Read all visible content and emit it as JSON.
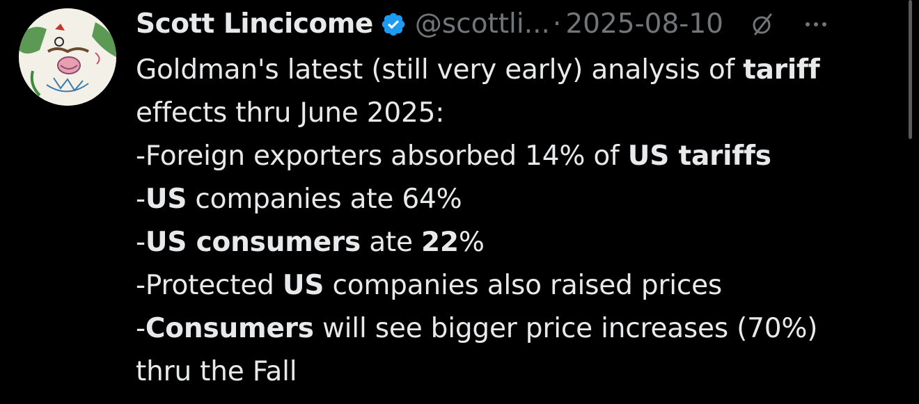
{
  "author": {
    "display_name": "Scott Lincicome",
    "handle": "@scottli...",
    "separator": "·",
    "date": "2025-08-10",
    "verified_icon": "verified-badge-icon",
    "verified_color": "#1d9bf0",
    "avatar_icon": "hand-drawn-face-avatar"
  },
  "actions": {
    "grok_icon": "grok-slash-icon",
    "more_icon": "more-dots-icon"
  },
  "tweet": {
    "lines": [
      [
        {
          "t": "Goldman's latest (still very early) analysis of ",
          "b": false
        },
        {
          "t": "tariff",
          "b": true
        }
      ],
      [
        {
          "t": "effects thru June 2025:",
          "b": false
        }
      ],
      [
        {
          "t": "-Foreign exporters absorbed 14% of ",
          "b": false
        },
        {
          "t": "US tariffs",
          "b": true
        }
      ],
      [
        {
          "t": "-",
          "b": false
        },
        {
          "t": "US",
          "b": true
        },
        {
          "t": " companies ate 64%",
          "b": false
        }
      ],
      [
        {
          "t": "-",
          "b": false
        },
        {
          "t": "US consumers",
          "b": true
        },
        {
          "t": " ate ",
          "b": false
        },
        {
          "t": "22",
          "b": true
        },
        {
          "t": "%",
          "b": false
        }
      ],
      [
        {
          "t": "-Protected ",
          "b": false
        },
        {
          "t": "US",
          "b": true
        },
        {
          "t": " companies also raised prices",
          "b": false
        }
      ],
      [
        {
          "t": "-",
          "b": false
        },
        {
          "t": "Consumers",
          "b": true
        },
        {
          "t": " will see bigger price increases (70%)",
          "b": false
        }
      ],
      [
        {
          "t": "thru the Fall",
          "b": false
        }
      ]
    ]
  },
  "colors": {
    "background": "#000000",
    "text": "#e7e9ea",
    "secondary": "#71767b"
  }
}
